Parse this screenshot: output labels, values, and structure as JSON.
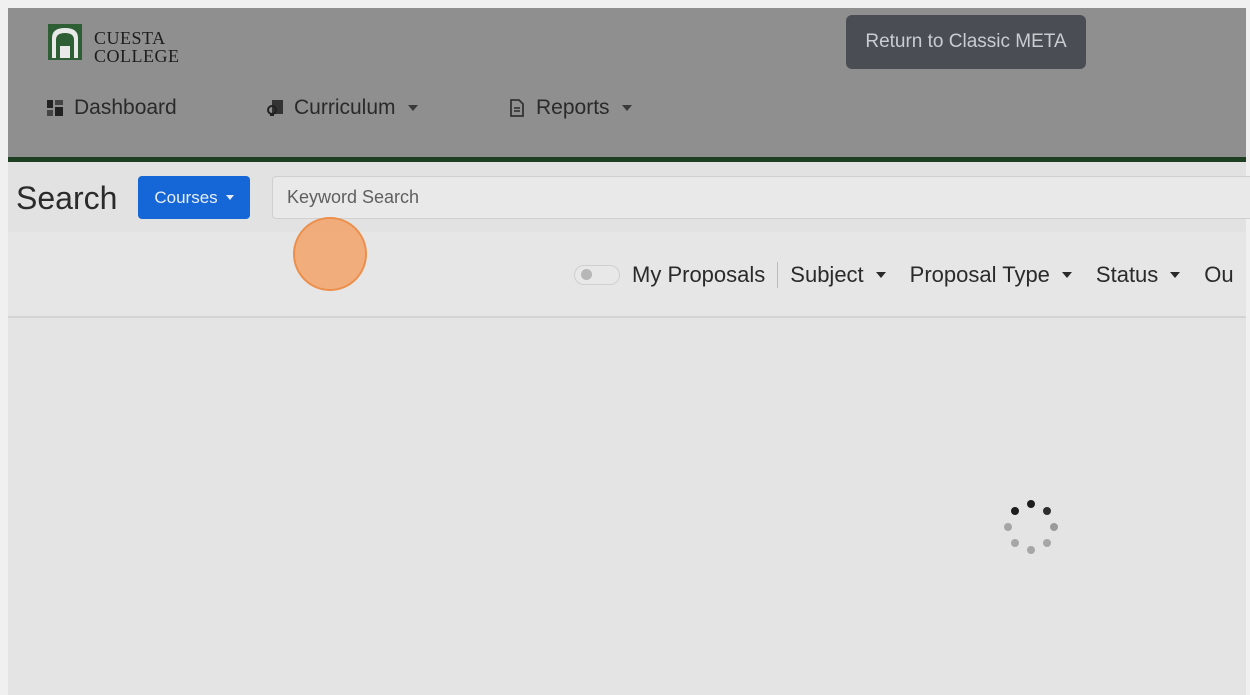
{
  "header": {
    "logo": {
      "line1": "CUESTA",
      "line2": "COLLEGE"
    },
    "return_button": "Return to Classic META",
    "nav": [
      {
        "label": "Dashboard",
        "icon": "dashboard-icon",
        "has_dropdown": false
      },
      {
        "label": "Curriculum",
        "icon": "curriculum-icon",
        "has_dropdown": true
      },
      {
        "label": "Reports",
        "icon": "reports-icon",
        "has_dropdown": true
      }
    ]
  },
  "search": {
    "title": "Search",
    "type_button": "Courses",
    "keyword_placeholder": "Keyword Search"
  },
  "filters": {
    "my_proposals_label": "My Proposals",
    "my_proposals_on": false,
    "subject": "Subject",
    "proposal_type": "Proposal Type",
    "status": "Status",
    "truncated_item": "Ou"
  },
  "colors": {
    "header_bg": "#8f8f8f",
    "accent_green": "#1f3f23",
    "primary_blue": "#1566d6",
    "click_marker": "#f3a269"
  }
}
